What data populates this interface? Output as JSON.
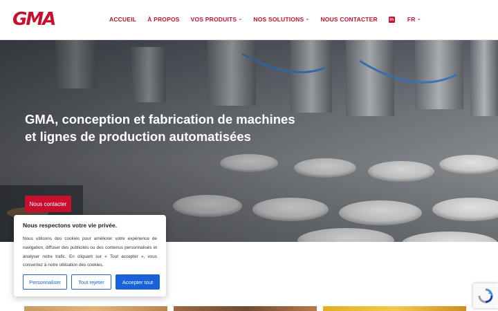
{
  "brand": {
    "logo_text": "GMA",
    "accent": "#c8102e"
  },
  "nav": {
    "items": [
      {
        "label": "ACCUEIL",
        "active": true,
        "dropdown": false
      },
      {
        "label": "À PROPOS",
        "active": false,
        "dropdown": false
      },
      {
        "label": "VOS PRODUITS",
        "active": false,
        "dropdown": true
      },
      {
        "label": "NOS SOLUTIONS",
        "active": false,
        "dropdown": true
      },
      {
        "label": "NOUS CONTACTER",
        "active": false,
        "dropdown": false
      }
    ],
    "linkedin_icon": "linkedin-icon",
    "language": "FR"
  },
  "hero": {
    "title": "GMA, conception et fabrication de machines et lignes de production automatisées",
    "cta_label": "Nous contacter"
  },
  "cookie": {
    "title": "Nous respectons votre vie privée.",
    "text": "Nous utilisons des cookies pour améliorer votre expérience de navigation, diffuser des publicités ou des contenus personnalisés et analyser notre trafic. En cliquant sur « Tout accepter », vous consentez à notre utilisation des cookies.",
    "buttons": {
      "customize": "Personnaliser",
      "reject": "Tout rejeter",
      "accept": "Accepter tout"
    },
    "button_color": "#1863dc"
  }
}
